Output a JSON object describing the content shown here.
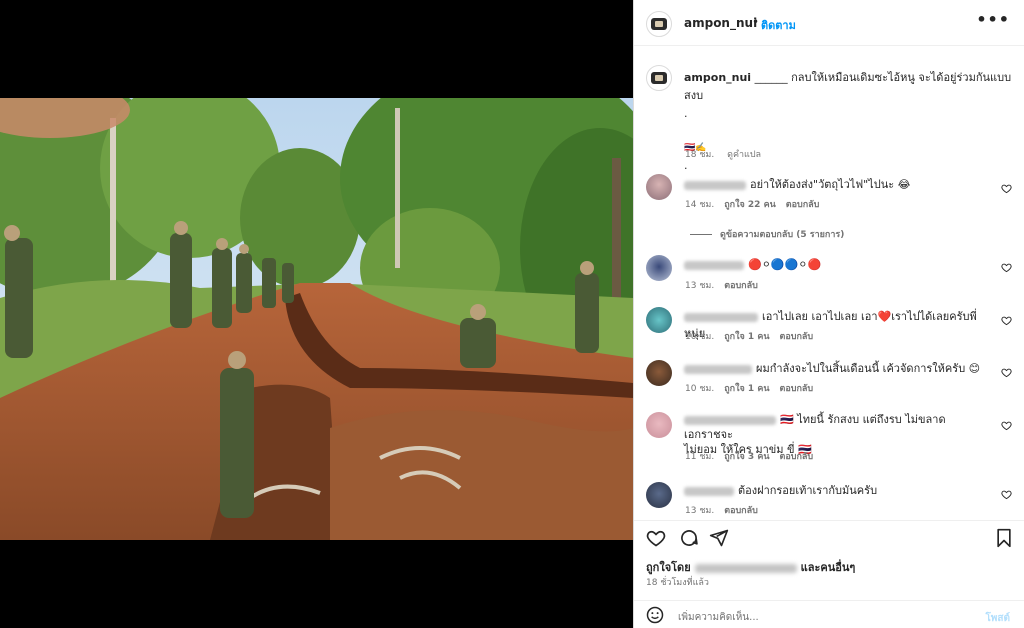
{
  "post": {
    "username": "ampon_nui",
    "separator": "•",
    "follow_label": "ติดตาม",
    "more_label": "•••"
  },
  "caption": {
    "username": "ampon_nui",
    "line1": "______ กลบให้เหมือนเดิมซะไอ้หนู จะได้อยู่ร่วมกันแบบสงบ",
    "line2": ".",
    "line3": "🇹🇭✍️",
    "line4": ".",
    "time": "18 ชม.",
    "translate": "ดูคำแปล"
  },
  "comments": [
    {
      "text": "อย่าให้ต้องส่ง\"วัตถุไวไฟ\"ไปนะ 😂",
      "time": "14 ชม.",
      "likes": "ถูกใจ 22 คน",
      "reply": "ตอบกลับ"
    },
    {
      "text": "🔴⚪🔵🔵⚪🔴",
      "time": "13 ชม.",
      "likes": "",
      "reply": "ตอบกลับ"
    },
    {
      "text": "เอาไปเลย เอาไปเลย เอา❤️เราไปได้เลยครับพี่หนุ่ย",
      "time": "10 ชม.",
      "likes": "ถูกใจ 1 คน",
      "reply": "ตอบกลับ"
    },
    {
      "text": "ผมกำลังจะไปในสิ้นเดือนนี้ เค้วจัดการให้ครับ 😊",
      "time": "10 ชม.",
      "likes": "ถูกใจ 1 คน",
      "reply": "ตอบกลับ"
    },
    {
      "text": "🇹🇭 ไทยนี้ รักสงบ แต่ถึงรบ ไม่ขลาด เอกราชจะ",
      "text2": "ไม่ยอม ให้ใคร มาข่ม ขี่ 🇹🇭",
      "time": "11 ชม.",
      "likes": "ถูกใจ 3 คน",
      "reply": "ตอบกลับ"
    },
    {
      "text": "ต้องฝากรอยเท้าเรากับมันครับ",
      "time": "13 ชม.",
      "likes": "",
      "reply": "ตอบกลับ"
    }
  ],
  "view_replies": "ดูข้อความตอบกลับ (5 รายการ)",
  "likes": {
    "prefix": "ถูกใจโดย",
    "suffix": "และคนอื่นๆ"
  },
  "time_ago": "18 ชั่วโมงที่แล้ว",
  "add_comment": {
    "placeholder": "เพิ่มความคิดเห็น...",
    "post_label": "โพสต์"
  },
  "colors": {
    "accent": "#0095f6",
    "secondary_text": "#737373",
    "post_disabled": "#b3dffc"
  },
  "icons": [
    "heart-icon",
    "comment-icon",
    "share-icon",
    "bookmark-icon",
    "emoji-icon",
    "more-icon"
  ]
}
